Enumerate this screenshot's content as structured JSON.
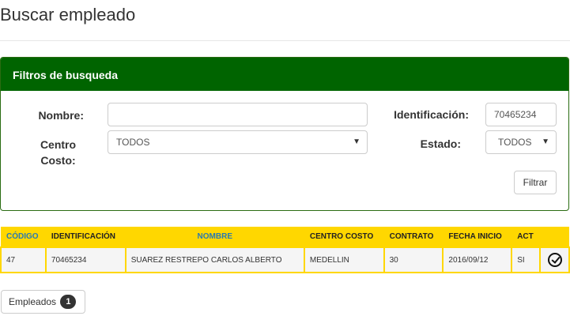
{
  "page": {
    "title": "Buscar empleado"
  },
  "filters": {
    "heading": "Filtros de busqueda",
    "nombre_label": "Nombre:",
    "nombre_value": "",
    "identificacion_label": "Identificación:",
    "identificacion_value": "70465234",
    "centro_costo_label_1": "Centro",
    "centro_costo_label_2": "Costo:",
    "centro_costo_selected": "TODOS",
    "estado_label": "Estado:",
    "estado_selected": "TODOS",
    "filtrar_label": "Filtrar"
  },
  "table": {
    "columns": [
      "CÓDIGO",
      "IDENTIFICACIÓN",
      "NOMBRE",
      "CENTRO COSTO",
      "CONTRATO",
      "FECHA INICIO",
      "ACT"
    ],
    "rows": [
      {
        "codigo": "47",
        "identificacion": "70465234",
        "nombre": "SUAREZ RESTREPO CARLOS ALBERTO",
        "centro_costo": "MEDELLIN",
        "contrato": "30",
        "fecha_inicio": "2016/09/12",
        "act": "SI",
        "action_icon": "check-circle-icon"
      }
    ]
  },
  "footer": {
    "empleados_label": "Empleados",
    "empleados_count": "1"
  }
}
